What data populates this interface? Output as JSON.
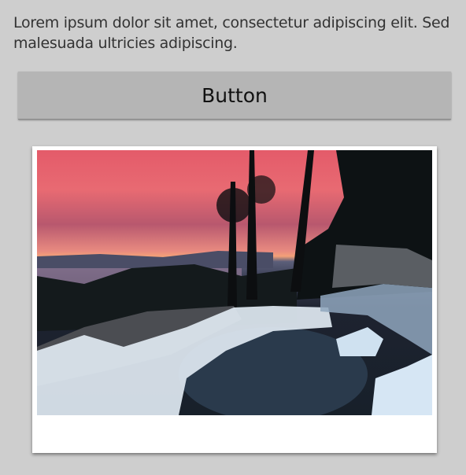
{
  "description": "Lorem ipsum dolor sit amet, consectetur adipiscing elit. Sed malesuada ultricies adipiscing.",
  "button": {
    "label": "Button"
  },
  "image": {
    "subject": "waterfall-at-sunset-photo"
  },
  "colors": {
    "background": "#cecece",
    "button": "#b5b5b5",
    "text": "#333333"
  }
}
